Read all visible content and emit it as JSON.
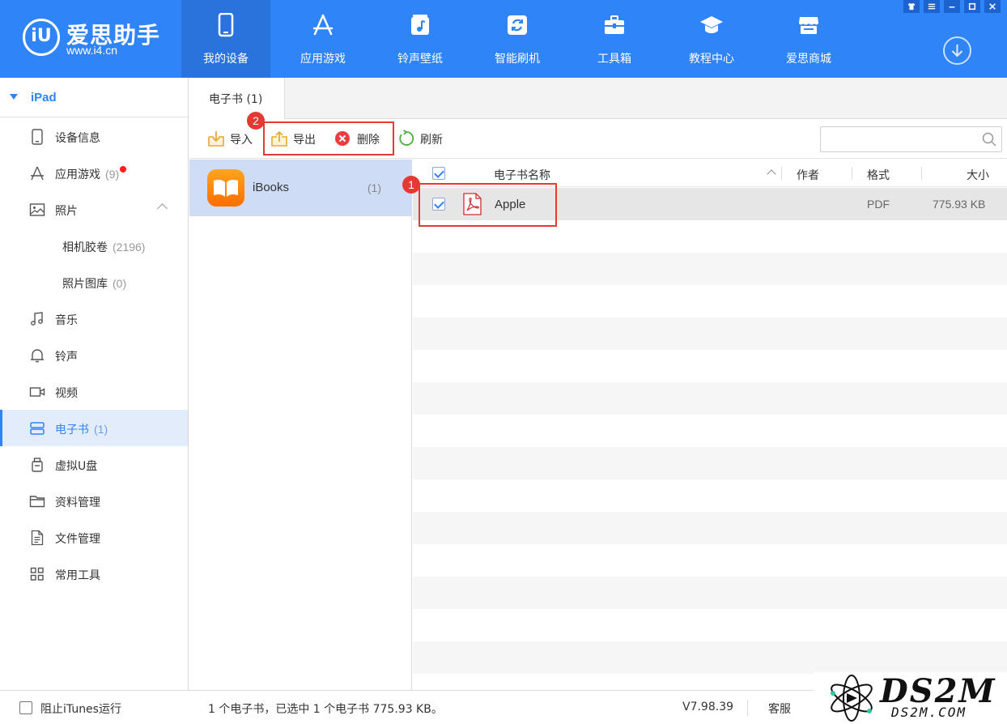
{
  "app": {
    "logo_glyph": "iU",
    "logo_name": "爱思助手",
    "logo_url": "www.i4.cn"
  },
  "nav": [
    {
      "label": "我的设备",
      "icon": "phone-icon",
      "active": true
    },
    {
      "label": "应用游戏",
      "icon": "app-store-icon"
    },
    {
      "label": "铃声壁纸",
      "icon": "music-note-icon"
    },
    {
      "label": "智能刷机",
      "icon": "refresh-box-icon"
    },
    {
      "label": "工具箱",
      "icon": "toolbox-icon"
    },
    {
      "label": "教程中心",
      "icon": "graduation-cap-icon"
    },
    {
      "label": "爱思商城",
      "icon": "store-icon"
    }
  ],
  "window_controls": [
    "shirt-icon",
    "menu-icon",
    "minimize-icon",
    "maximize-icon",
    "close-icon"
  ],
  "sidebar": {
    "device": "iPad",
    "items": [
      {
        "label": "设备信息",
        "icon": "device-info-icon"
      },
      {
        "label": "应用游戏",
        "count": "(9)",
        "icon": "app-icon",
        "dot": true
      },
      {
        "label": "照片",
        "icon": "photo-icon",
        "expanded": true
      },
      {
        "label": "相机胶卷",
        "count": "(2196)",
        "sub": true
      },
      {
        "label": "照片图库",
        "count": "(0)",
        "sub": true
      },
      {
        "label": "音乐",
        "icon": "music-icon"
      },
      {
        "label": "铃声",
        "icon": "bell-icon"
      },
      {
        "label": "视频",
        "icon": "video-icon"
      },
      {
        "label": "电子书",
        "count": "(1)",
        "icon": "ebook-icon",
        "active": true
      },
      {
        "label": "虚拟U盘",
        "icon": "usb-drive-icon"
      },
      {
        "label": "资料管理",
        "icon": "folder-icon"
      },
      {
        "label": "文件管理",
        "icon": "file-icon"
      },
      {
        "label": "常用工具",
        "icon": "grid-icon"
      }
    ]
  },
  "tab": {
    "label": "电子书 (1)"
  },
  "toolbar": {
    "import": "导入",
    "export": "导出",
    "delete": "删除",
    "refresh": "刷新",
    "search_placeholder": ""
  },
  "library": {
    "name": "iBooks",
    "count": "(1)"
  },
  "table": {
    "columns": {
      "name": "电子书名称",
      "author": "作者",
      "format": "格式",
      "size": "大小"
    },
    "rows": [
      {
        "name": "Apple",
        "author": "",
        "format": "PDF",
        "size": "775.93 KB",
        "checked": true
      }
    ]
  },
  "annotations": {
    "badge1": "1",
    "badge2": "2"
  },
  "colors": {
    "accent": "#2f84f7",
    "highlight": "#e53935"
  },
  "status": {
    "block_itunes": "阻止iTunes运行",
    "summary": "1 个电子书，已选中 1 个电子书 775.93 KB。",
    "version": "V7.98.39",
    "support": "客服"
  },
  "watermark": {
    "big": "DS2M",
    "small": "DS2M.COM"
  }
}
